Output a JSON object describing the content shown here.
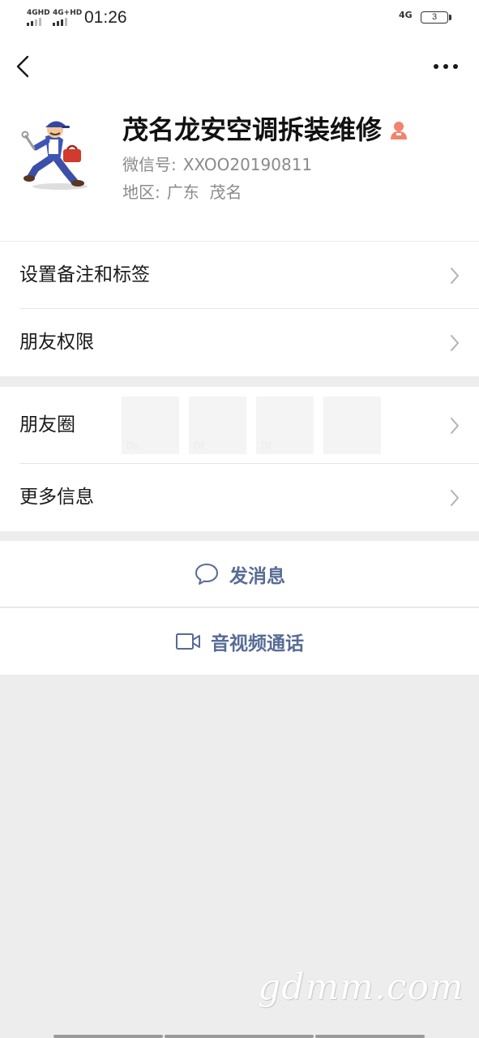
{
  "status_bar": {
    "sim1_network": "4GHD",
    "sim2_network": "4G+HD",
    "time": "01:26",
    "right_network": "4G",
    "battery_level": "3"
  },
  "profile": {
    "nickname": "茂名龙安空调拆装维修",
    "wechat_id_label": "微信号:",
    "wechat_id": "XXOO20190811",
    "region_label": "地区:",
    "region": "广东  茂名"
  },
  "menu": {
    "remark_label": "设置备注和标签",
    "permissions_label": "朋友权限",
    "moments_label": "朋友圈",
    "more_info_label": "更多信息",
    "moments_thumbnails": [
      "Dy",
      "DF",
      "DF",
      ""
    ]
  },
  "actions": {
    "message_label": "发消息",
    "call_label": "音视频通话"
  },
  "watermark": "gdmm.com",
  "colors": {
    "link": "#576b95",
    "background": "#ededed",
    "card": "#ffffff",
    "badge": "#f0846c"
  },
  "icons": {
    "back": "back-arrow-icon",
    "more": "more-dots-icon",
    "badge": "person-badge-icon",
    "message": "chat-bubble-icon",
    "call": "video-camera-icon",
    "chevron": "chevron-right-icon"
  }
}
